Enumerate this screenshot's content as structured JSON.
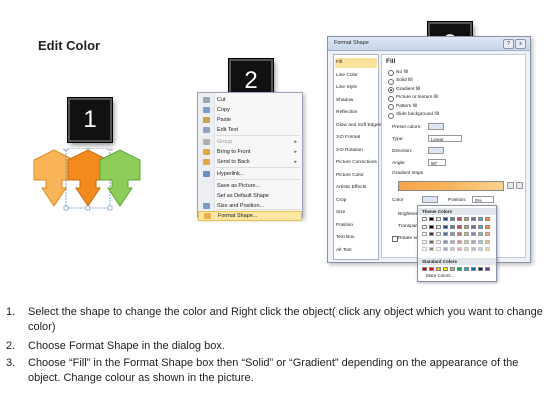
{
  "title": "Edit Color",
  "badges": [
    "1",
    "2",
    "3"
  ],
  "context_menu": {
    "items": [
      {
        "label": "Cut",
        "icon": "scissors-icon",
        "color": "#9aa7b8"
      },
      {
        "label": "Copy",
        "icon": "copy-icon",
        "color": "#7c9cc9"
      },
      {
        "label": "Paste",
        "icon": "paste-icon",
        "color": "#c9a44f"
      },
      {
        "label": "Edit Text",
        "icon": "edit-text-icon",
        "color": "#8fa3c0"
      },
      {
        "label": "Group",
        "icon": "group-icon",
        "color": "#b0b0b0",
        "disabled": true,
        "submenu": true
      },
      {
        "label": "Bring to Front",
        "icon": "bring-to-front-icon",
        "color": "#e2a64a",
        "submenu": true
      },
      {
        "label": "Send to Back",
        "icon": "send-to-back-icon",
        "color": "#e2a64a",
        "submenu": true
      },
      {
        "label": "Hyperlink...",
        "icon": "hyperlink-icon",
        "color": "#6a8fc7"
      },
      {
        "label": "Save as Picture...",
        "icon": "",
        "color": ""
      },
      {
        "label": "Set as Default Shape",
        "icon": "",
        "color": ""
      },
      {
        "label": "Size and Position...",
        "icon": "size-position-icon",
        "color": "#7b9bc6"
      },
      {
        "label": "Format Shape...",
        "icon": "format-shape-icon",
        "color": "#e9b04c",
        "highlighted": true
      }
    ]
  },
  "dialog": {
    "title": "Format Shape",
    "window_buttons": [
      "?",
      "x"
    ],
    "nav": [
      "Fill",
      "Line Color",
      "Line Style",
      "Shadow",
      "Reflection",
      "Glow and Soft Edges",
      "3-D Format",
      "3-D Rotation",
      "Picture Corrections",
      "Picture Color",
      "Artistic Effects",
      "Crop",
      "Size",
      "Position",
      "Text Box",
      "Alt Text"
    ],
    "selected_nav": "Fill",
    "section_title": "Fill",
    "fill_options": [
      "No fill",
      "Solid fill",
      "Gradient fill",
      "Picture or texture fill",
      "Pattern fill",
      "Slide background fill"
    ],
    "selected_fill": "Gradient fill",
    "preset_colors_label": "Preset colors:",
    "type_label": "Type:",
    "type_value": "Linear",
    "direction_label": "Direction:",
    "angle_label": "Angle:",
    "angle_value": "90°",
    "gradient_stops_label": "Gradient stops",
    "color_label": "Color",
    "position_label": "Position:",
    "position_value": "0%",
    "brightness_label": "Brightness:",
    "transparency_label": "Transparency:",
    "rotate_label": "Rotate w",
    "palette": {
      "theme_colors_label": "Theme Colors",
      "standard_colors_label": "Standard Colors",
      "more_colors_label": "More Colors..."
    }
  },
  "instructions": [
    {
      "num": "1.",
      "text": "Select the shape to change the color and Right click the object( click any object which you want to change color)"
    },
    {
      "num": "2.",
      "text": "Choose Format Shape in the dialog box."
    },
    {
      "num": "3.",
      "text": "Choose “Fill” in the Format Shape box then “Solid” or “Gradient” depending on the appearance of the object. Change colour as shown in the picture."
    }
  ],
  "colors": {
    "arrow_orange_light": "#f8b457",
    "arrow_orange": "#f28a1e",
    "arrow_green": "#8fcd5b",
    "selection": "#6c8ebf",
    "highlight": "#fbe29c"
  }
}
